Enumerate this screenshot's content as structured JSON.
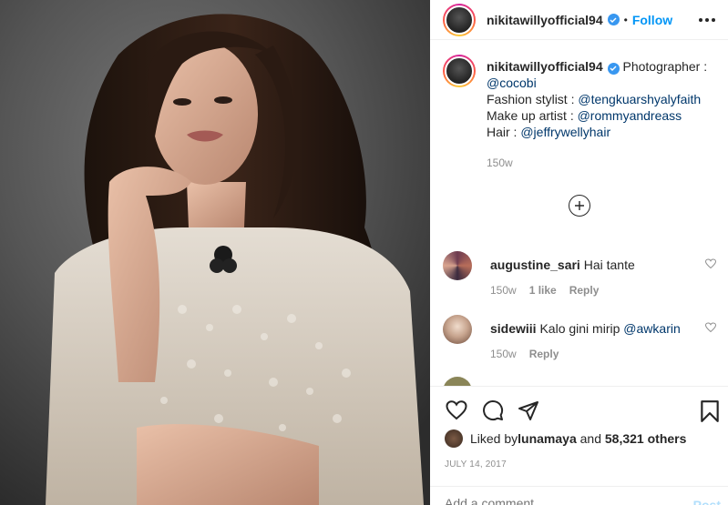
{
  "post": {
    "username": "nikitawillyofficial94",
    "follow_label": "Follow",
    "separator": "•"
  },
  "caption": {
    "username": "nikitawillyofficial94",
    "line1_text": " Photographer : ",
    "line1_mention": "@cocobi",
    "line2_text": "Fashion stylist : ",
    "line2_mention": "@tengkuarshyalyfaith",
    "line3_text": "Make up artist : ",
    "line3_mention": "@rommyandreass",
    "line4_text": "Hair : ",
    "line4_mention": "@jeffrywellyhair",
    "time": "150w"
  },
  "comments": [
    {
      "username": "augustine_sari",
      "text": "Hai tante",
      "time": "150w",
      "likes": "1 like",
      "reply": "Reply"
    },
    {
      "username": "sidewiii",
      "text": "Kalo gini mirip ",
      "mention": "@awkarin",
      "time": "150w",
      "reply": "Reply"
    }
  ],
  "likes": {
    "prefix": "Liked by ",
    "user": "lunamaya",
    "middle": " and ",
    "others": "58,321 others"
  },
  "date": "JULY 14, 2017",
  "add_comment": {
    "placeholder": "Add a comment…",
    "post_label": "Post"
  },
  "icons": [
    "verified-badge-icon",
    "more-options-icon",
    "load-more-plus-icon",
    "heart-icon",
    "comment-icon",
    "share-icon",
    "bookmark-icon"
  ],
  "colors": {
    "link": "#0095f6",
    "mention": "#00376b",
    "muted": "#8e8e8e",
    "verified": "#3897f0"
  }
}
